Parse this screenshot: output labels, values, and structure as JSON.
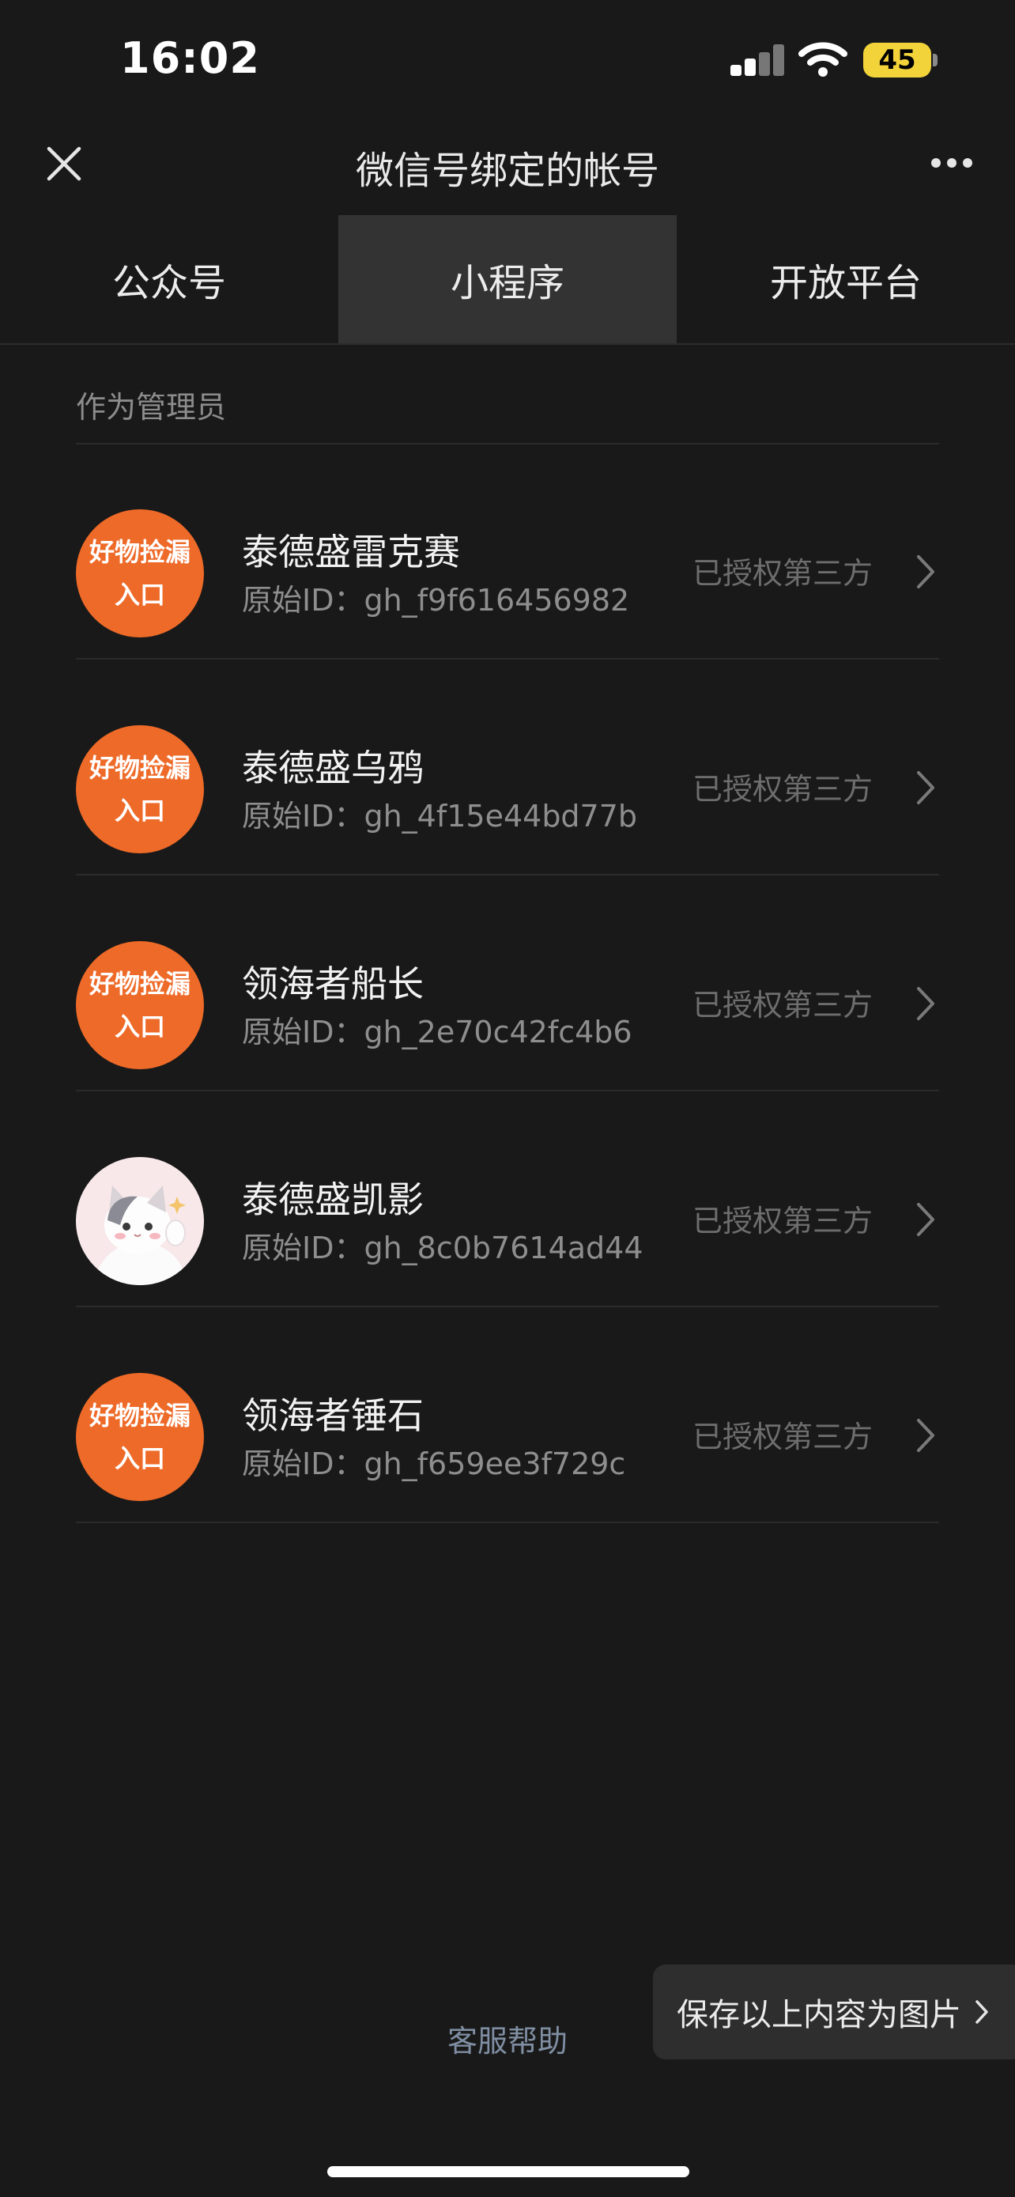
{
  "status_bar": {
    "time": "16:02",
    "battery": "45"
  },
  "nav": {
    "title": "微信号绑定的帐号"
  },
  "tabs": [
    {
      "label": "公众号",
      "active": false
    },
    {
      "label": "小程序",
      "active": true
    },
    {
      "label": "开放平台",
      "active": false
    }
  ],
  "section_label": "作为管理员",
  "items": [
    {
      "avatar_line1": "好物捡漏",
      "avatar_line2": "入口",
      "name": "泰德盛雷克赛",
      "origin_id": "原始ID：gh_f9f616456982",
      "status": "已授权第三方"
    },
    {
      "avatar_line1": "好物捡漏",
      "avatar_line2": "入口",
      "name": "泰德盛乌鸦",
      "origin_id": "原始ID：gh_4f15e44bd77b",
      "status": "已授权第三方"
    },
    {
      "avatar_line1": "好物捡漏",
      "avatar_line2": "入口",
      "name": "领海者船长",
      "origin_id": "原始ID：gh_2e70c42fc4b6",
      "status": "已授权第三方"
    },
    {
      "avatar_icon": "cat-avatar-icon",
      "name": "泰德盛凯影",
      "origin_id": "原始ID：gh_8c0b7614ad44",
      "status": "已授权第三方"
    },
    {
      "avatar_line1": "好物捡漏",
      "avatar_line2": "入口",
      "name": "领海者锤石",
      "origin_id": "原始ID：gh_f659ee3f729c",
      "status": "已授权第三方"
    }
  ],
  "footer": {
    "help": "客服帮助",
    "save_label": "保存以上内容为图片"
  },
  "colors": {
    "background": "#191919",
    "avatar_orange": "#ee6a28",
    "battery": "#f3d33a",
    "help_link": "#7f8ea2"
  }
}
